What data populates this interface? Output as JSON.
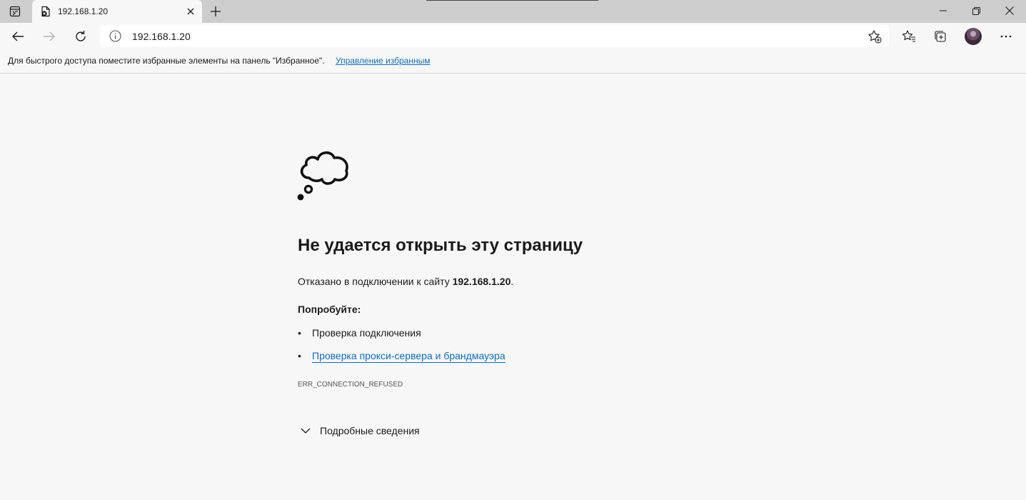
{
  "browser": {
    "tab": {
      "title": "192.168.1.20",
      "favicon": "page-error-icon",
      "close_icon": "close-icon"
    },
    "new_tab_icon": "plus-icon",
    "tab_actions_icon": "tab-actions-icon",
    "window_controls": [
      "minimize-icon",
      "restore-icon",
      "close-icon"
    ]
  },
  "toolbar": {
    "back_icon": "arrow-left-icon",
    "forward_icon": "arrow-right-icon",
    "refresh_icon": "refresh-icon",
    "address": {
      "url": "192.168.1.20",
      "site_info_icon": "info-icon",
      "add_favorite_icon": "star-add-icon"
    },
    "favorites_icon": "favorites-icon",
    "collections_icon": "collections-icon",
    "profile_icon": "avatar",
    "more_icon": "more-icon"
  },
  "favorites_bar": {
    "message": "Для быстрого доступа поместите избранные элементы на панель \"Избранное\".",
    "manage_link": "Управление избранным"
  },
  "error_page": {
    "icon": "cloud-thought-icon",
    "title": "Не удается открыть эту страницу",
    "description_prefix": "Отказано в подключении к сайту ",
    "host": "192.168.1.20",
    "description_suffix": ".",
    "try_heading": "Попробуйте:",
    "suggestions": [
      {
        "text": "Проверка подключения",
        "link": false
      },
      {
        "text": "Проверка прокси-сервера и брандмауэра",
        "link": true
      }
    ],
    "bullet": "•",
    "error_code": "ERR_CONNECTION_REFUSED",
    "details_label": "Подробные сведения",
    "details_icon": "chevron-down-icon"
  },
  "colors": {
    "link": "#0f6cbd",
    "tabstrip": "#cdcdcd",
    "page_bg": "#f7f7f7",
    "text": "#1b1b1b"
  }
}
